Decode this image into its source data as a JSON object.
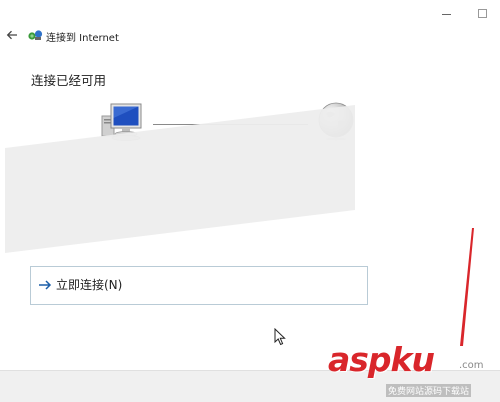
{
  "window": {
    "title": "连接到 Internet",
    "controls": {
      "minimize": "—",
      "maximize": "□"
    }
  },
  "status": {
    "heading": "连接已经可用"
  },
  "action": {
    "connect_arrow": "→",
    "connect_label": "立即连接(N)"
  },
  "icons": {
    "back": "back-arrow-icon",
    "network": "network-connections-icon",
    "computer": "computer-icon",
    "internet": "globe-icon",
    "pointer": "mouse-cursor-icon"
  },
  "watermark": {
    "logo": "aspku",
    "dotcom": ".com",
    "subtitle": "免费网站源码下载站"
  },
  "colors": {
    "accent_border": "#b9cbd6",
    "watermark_red": "#d9262b",
    "monitor_blue": "#1f4fbf"
  }
}
